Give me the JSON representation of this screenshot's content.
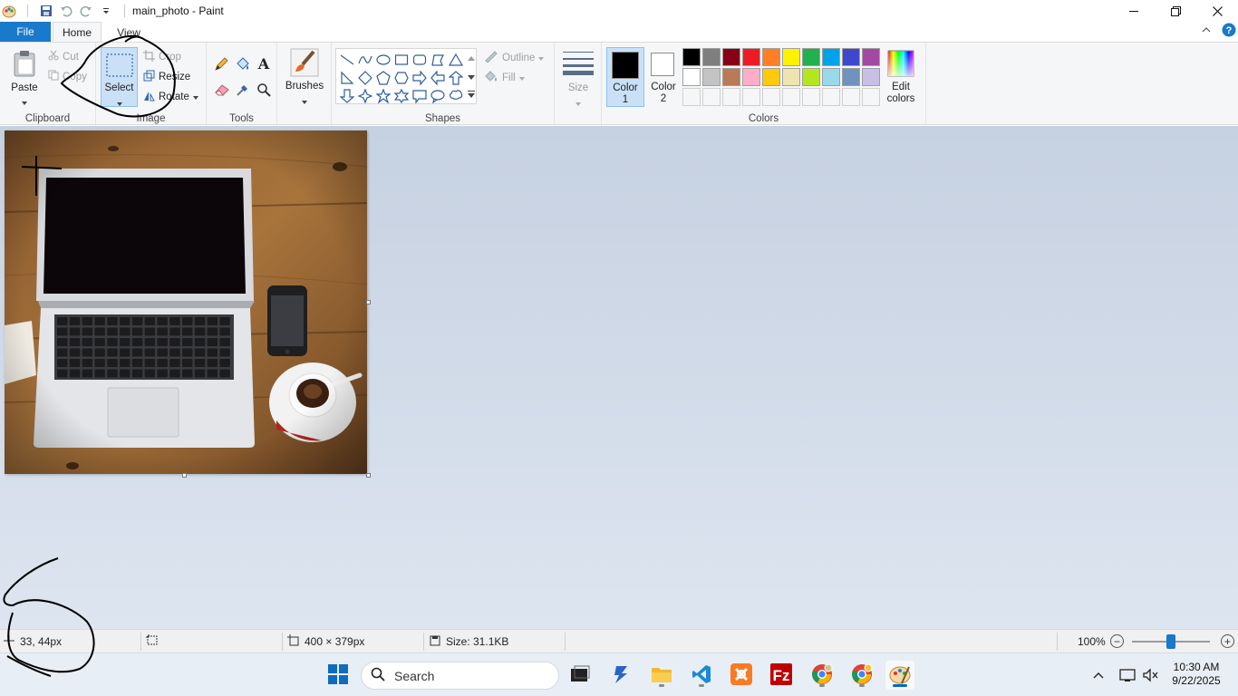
{
  "window": {
    "title": "main_photo - Paint",
    "controls": [
      "minimize-icon",
      "restore-icon",
      "close-icon"
    ]
  },
  "ribbon_tabs": {
    "file": "File",
    "home": "Home",
    "view": "View"
  },
  "clipboard": {
    "paste": "Paste",
    "cut": "Cut",
    "copy": "Copy",
    "label": "Clipboard"
  },
  "image_group": {
    "select": "Select",
    "crop": "Crop",
    "resize": "Resize",
    "rotate": "Rotate",
    "label": "Image"
  },
  "tools": {
    "label": "Tools"
  },
  "brushes": {
    "label": "Brushes"
  },
  "shapes": {
    "outline": "Outline",
    "fill": "Fill",
    "label": "Shapes"
  },
  "size": {
    "label": "Size"
  },
  "colors": {
    "color1_label": "Color\n1",
    "color1_line1": "Color",
    "color1_line2": "1",
    "color2_line1": "Color",
    "color2_line2": "2",
    "edit_line1": "Edit",
    "edit_line2": "colors",
    "label": "Colors",
    "color1": "#000000",
    "color2": "#ffffff",
    "palette": [
      "#000000",
      "#7f7f7f",
      "#880015",
      "#ed1c24",
      "#ff7f27",
      "#fff200",
      "#22b14c",
      "#00a2e8",
      "#3f48cc",
      "#a349a4",
      "#ffffff",
      "#c3c3c3",
      "#b97a57",
      "#ffaec9",
      "#ffc90e",
      "#efe4b0",
      "#b5e61d",
      "#99d9ea",
      "#7092be",
      "#c8bfe7"
    ]
  },
  "status": {
    "cursor_pos": "33, 44px",
    "image_size": "400 × 379px",
    "file_size": "Size: 31.1KB",
    "zoom": "100%"
  },
  "taskbar": {
    "search_placeholder": "Search",
    "time": "10:30 AM",
    "date": "9/22/2025"
  }
}
